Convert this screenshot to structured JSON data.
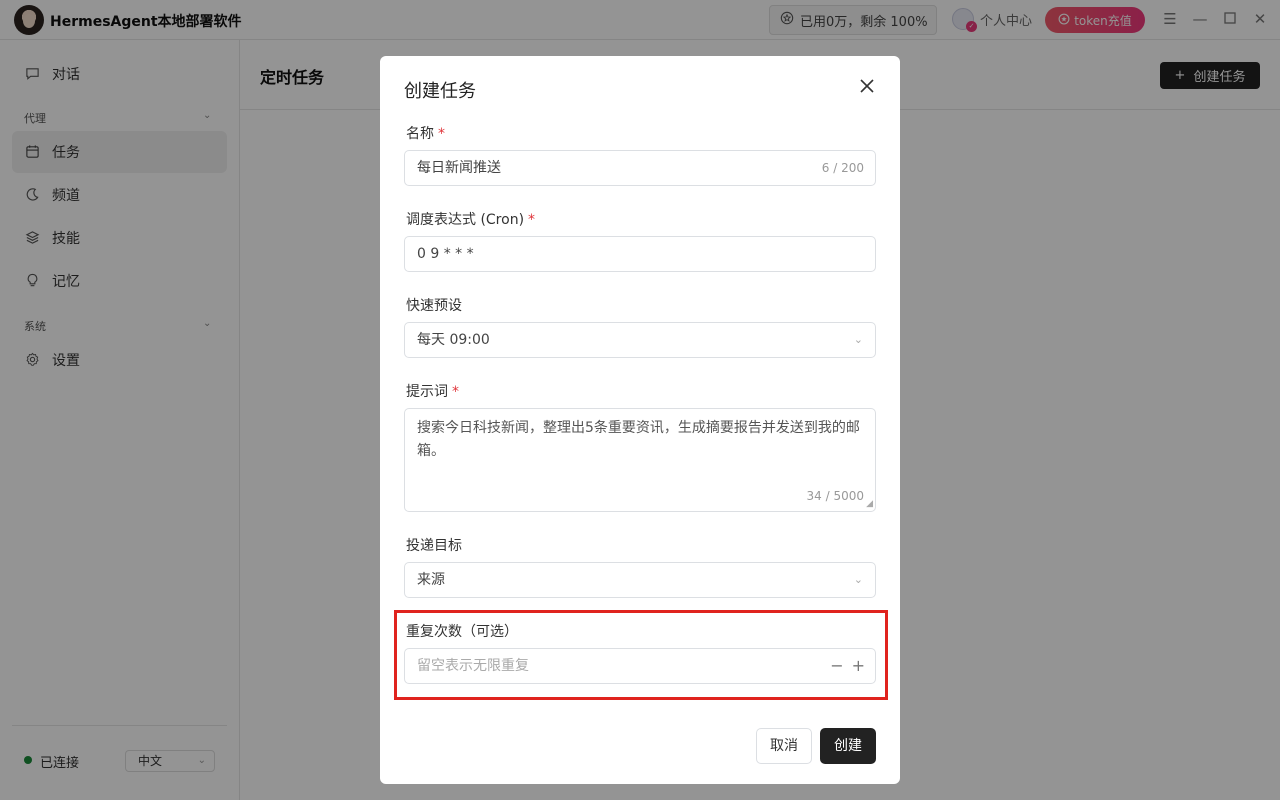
{
  "app": {
    "title": "HermesAgent本地部署软件"
  },
  "header": {
    "usage_text": "已用0万，剩余 100%",
    "user_center": "个人中心",
    "token_button": "token充值"
  },
  "sidebar": {
    "chat": "对话",
    "group_agent": "代理",
    "tasks": "任务",
    "channels": "频道",
    "skills": "技能",
    "memory": "记忆",
    "group_system": "系统",
    "settings": "设置",
    "status": "已连接",
    "language": "中文"
  },
  "main": {
    "page_title": "定时任务",
    "create_button": "创建任务"
  },
  "modal": {
    "title": "创建任务",
    "name_label": "名称",
    "name_value": "每日新闻推送",
    "name_counter": "6 / 200",
    "cron_label": "调度表达式 (Cron)",
    "cron_value": "0 9 * * *",
    "preset_label": "快速预设",
    "preset_value": "每天 09:00",
    "prompt_label": "提示词",
    "prompt_value": "搜索今日科技新闻，整理出5条重要资讯，生成摘要报告并发送到我的邮箱。",
    "prompt_counter": "34 / 5000",
    "target_label": "投递目标",
    "target_value": "来源",
    "repeat_label": "重复次数（可选）",
    "repeat_placeholder": "留空表示无限重复",
    "required_mark": "*",
    "cancel_button": "取消",
    "create_button": "创建"
  },
  "colors": {
    "primary_button": "#222222",
    "token_gradient_start": "#f25a6a",
    "token_gradient_end": "#f0387d",
    "required": "#e0353b",
    "highlight_border": "#e0231e",
    "status_connected": "#1a8a3a"
  }
}
